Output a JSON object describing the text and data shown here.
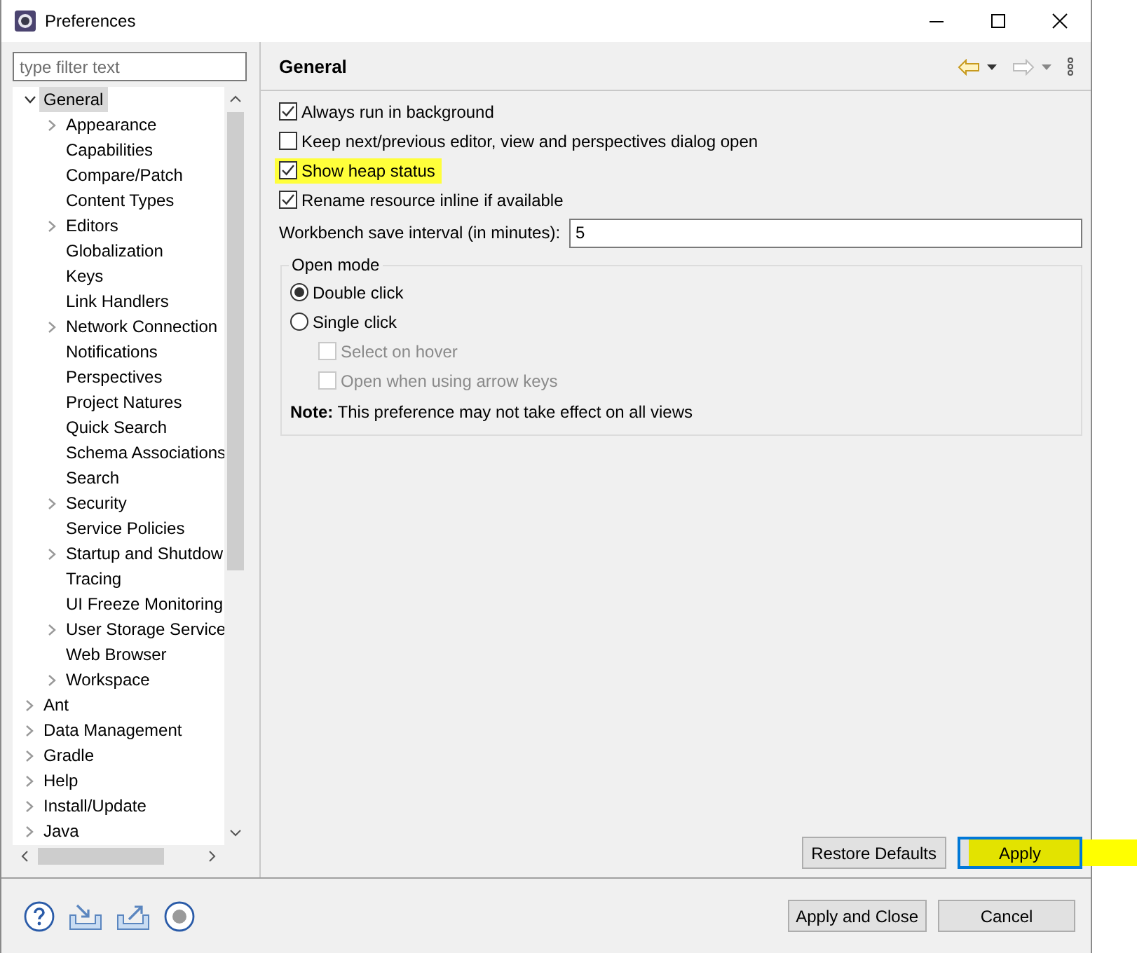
{
  "window": {
    "title": "Preferences"
  },
  "filter": {
    "placeholder": "type filter text"
  },
  "tree": [
    {
      "label": "General",
      "expandable": true,
      "expanded": true,
      "selected": true,
      "children": [
        {
          "label": "Appearance",
          "expandable": true,
          "expanded": false,
          "selected": false
        },
        {
          "label": "Capabilities",
          "expandable": false,
          "selected": false
        },
        {
          "label": "Compare/Patch",
          "expandable": false,
          "selected": false
        },
        {
          "label": "Content Types",
          "expandable": false,
          "selected": false
        },
        {
          "label": "Editors",
          "expandable": true,
          "expanded": false,
          "selected": false
        },
        {
          "label": "Globalization",
          "expandable": false,
          "selected": false
        },
        {
          "label": "Keys",
          "expandable": false,
          "selected": false
        },
        {
          "label": "Link Handlers",
          "expandable": false,
          "selected": false
        },
        {
          "label": "Network Connection",
          "expandable": true,
          "expanded": false,
          "selected": false
        },
        {
          "label": "Notifications",
          "expandable": false,
          "selected": false
        },
        {
          "label": "Perspectives",
          "expandable": false,
          "selected": false
        },
        {
          "label": "Project Natures",
          "expandable": false,
          "selected": false
        },
        {
          "label": "Quick Search",
          "expandable": false,
          "selected": false
        },
        {
          "label": "Schema Associations",
          "expandable": false,
          "selected": false
        },
        {
          "label": "Search",
          "expandable": false,
          "selected": false
        },
        {
          "label": "Security",
          "expandable": true,
          "expanded": false,
          "selected": false
        },
        {
          "label": "Service Policies",
          "expandable": false,
          "selected": false
        },
        {
          "label": "Startup and Shutdow",
          "expandable": true,
          "expanded": false,
          "selected": false
        },
        {
          "label": "Tracing",
          "expandable": false,
          "selected": false
        },
        {
          "label": "UI Freeze Monitoring",
          "expandable": false,
          "selected": false
        },
        {
          "label": "User Storage Service",
          "expandable": true,
          "expanded": false,
          "selected": false
        },
        {
          "label": "Web Browser",
          "expandable": false,
          "selected": false
        },
        {
          "label": "Workspace",
          "expandable": true,
          "expanded": false,
          "selected": false
        }
      ]
    },
    {
      "label": "Ant",
      "expandable": true,
      "expanded": false,
      "selected": false
    },
    {
      "label": "Data Management",
      "expandable": true,
      "expanded": false,
      "selected": false
    },
    {
      "label": "Gradle",
      "expandable": true,
      "expanded": false,
      "selected": false
    },
    {
      "label": "Help",
      "expandable": true,
      "expanded": false,
      "selected": false
    },
    {
      "label": "Install/Update",
      "expandable": true,
      "expanded": false,
      "selected": false
    },
    {
      "label": "Java",
      "expandable": true,
      "expanded": false,
      "selected": false
    }
  ],
  "page": {
    "title": "General",
    "options": [
      {
        "label": "Always run in background",
        "checked": true,
        "highlighted": false
      },
      {
        "label": "Keep next/previous editor, view and perspectives dialog open",
        "checked": false,
        "highlighted": false
      },
      {
        "label": "Show heap status",
        "checked": true,
        "highlighted": true
      },
      {
        "label": "Rename resource inline if available",
        "checked": true,
        "highlighted": false
      }
    ],
    "interval": {
      "label": "Workbench save interval (in minutes):",
      "value": "5"
    },
    "open_mode": {
      "title": "Open mode",
      "options": [
        {
          "kind": "radio",
          "label": "Double click",
          "selected": true,
          "disabled": false
        },
        {
          "kind": "radio",
          "label": "Single click",
          "selected": false,
          "disabled": false
        },
        {
          "kind": "checkbox",
          "label": "Select on hover",
          "checked": false,
          "disabled": true
        },
        {
          "kind": "checkbox",
          "label": "Open when using arrow keys",
          "checked": false,
          "disabled": true
        }
      ],
      "note": "**Note:** This preference may not take effect on all views"
    },
    "buttons": [
      {
        "label": "Restore Defaults",
        "focused": false,
        "highlighted": false
      },
      {
        "label": "Apply",
        "focused": true,
        "highlighted": true
      }
    ]
  },
  "footer": {
    "buttons": [
      {
        "label": "Apply and Close"
      },
      {
        "label": "Cancel"
      }
    ]
  }
}
